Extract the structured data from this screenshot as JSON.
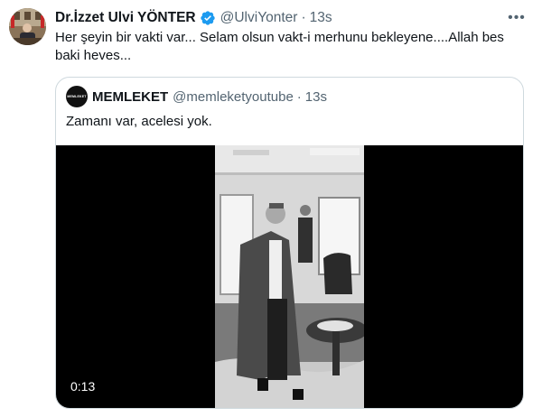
{
  "tweet": {
    "author_name": "Dr.İzzet Ulvi YÖNTER",
    "handle": "@UlviYonter",
    "separator": "·",
    "time": "13s",
    "more_icon": "more-horizontal-icon",
    "text": "Her şeyin bir vakti var... Selam olsun vakt-i merhunu bekleyene....Allah bes baki heves...",
    "verified_color": "#1d9bf0"
  },
  "quote": {
    "avatar_text": "MEMLEKET",
    "name": "MEMLEKET",
    "handle": "@memleketyoutube",
    "separator": "·",
    "time": "13s",
    "text": "Zamanı var, acelesi yok.",
    "video": {
      "duration": "0:13"
    }
  }
}
